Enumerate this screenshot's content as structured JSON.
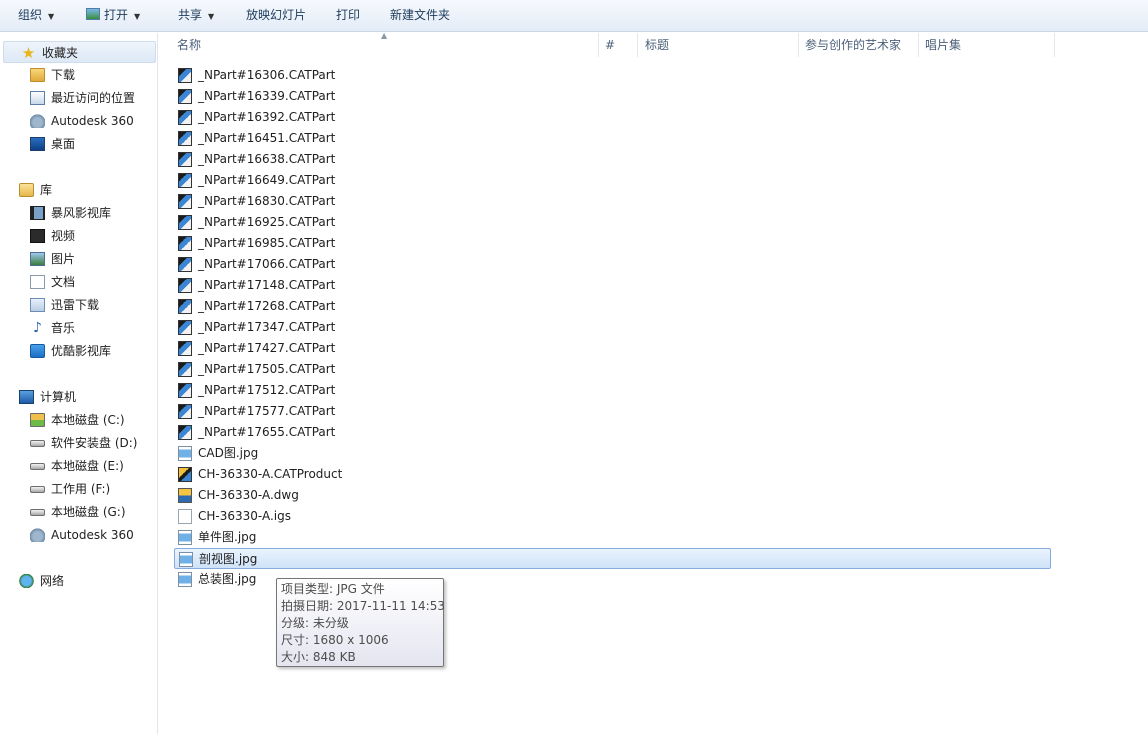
{
  "toolbar": {
    "organize": "组织",
    "open": "打开",
    "share": "共享",
    "slideshow": "放映幻灯片",
    "print": "打印",
    "new_folder": "新建文件夹"
  },
  "nav": {
    "favorites": "收藏夹",
    "fav_items": [
      "下载",
      "最近访问的位置",
      "Autodesk 360",
      "桌面"
    ],
    "library": "库",
    "lib_items": [
      "暴风影视库",
      "视频",
      "图片",
      "文档",
      "迅雷下载",
      "音乐",
      "优酷影视库"
    ],
    "computer": "计算机",
    "drives": [
      "本地磁盘 (C:)",
      "软件安装盘 (D:)",
      "本地磁盘 (E:)",
      "工作用 (F:)",
      "本地磁盘 (G:)",
      "Autodesk 360"
    ],
    "network": "网络"
  },
  "columns": {
    "name": "名称",
    "number": "#",
    "title": "标题",
    "artist": "参与创作的艺术家",
    "album": "唱片集"
  },
  "files": [
    "_NPart#16306.CATPart",
    "_NPart#16339.CATPart",
    "_NPart#16392.CATPart",
    "_NPart#16451.CATPart",
    "_NPart#16638.CATPart",
    "_NPart#16649.CATPart",
    "_NPart#16830.CATPart",
    "_NPart#16925.CATPart",
    "_NPart#16985.CATPart",
    "_NPart#17066.CATPart",
    "_NPart#17148.CATPart",
    "_NPart#17268.CATPart",
    "_NPart#17347.CATPart",
    "_NPart#17427.CATPart",
    "_NPart#17505.CATPart",
    "_NPart#17512.CATPart",
    "_NPart#17577.CATPart",
    "_NPart#17655.CATPart",
    "CAD图.jpg",
    "CH-36330-A.CATProduct",
    "CH-36330-A.dwg",
    "CH-36330-A.igs",
    "单件图.jpg",
    "剖视图.jpg",
    "总装图.jpg"
  ],
  "tooltip": {
    "lines": [
      "项目类型: JPG 文件",
      "拍摄日期: 2017-11-11 14:53",
      "分级: 未分级",
      "尺寸: 1680 x 1006",
      "大小: 848 KB"
    ]
  }
}
